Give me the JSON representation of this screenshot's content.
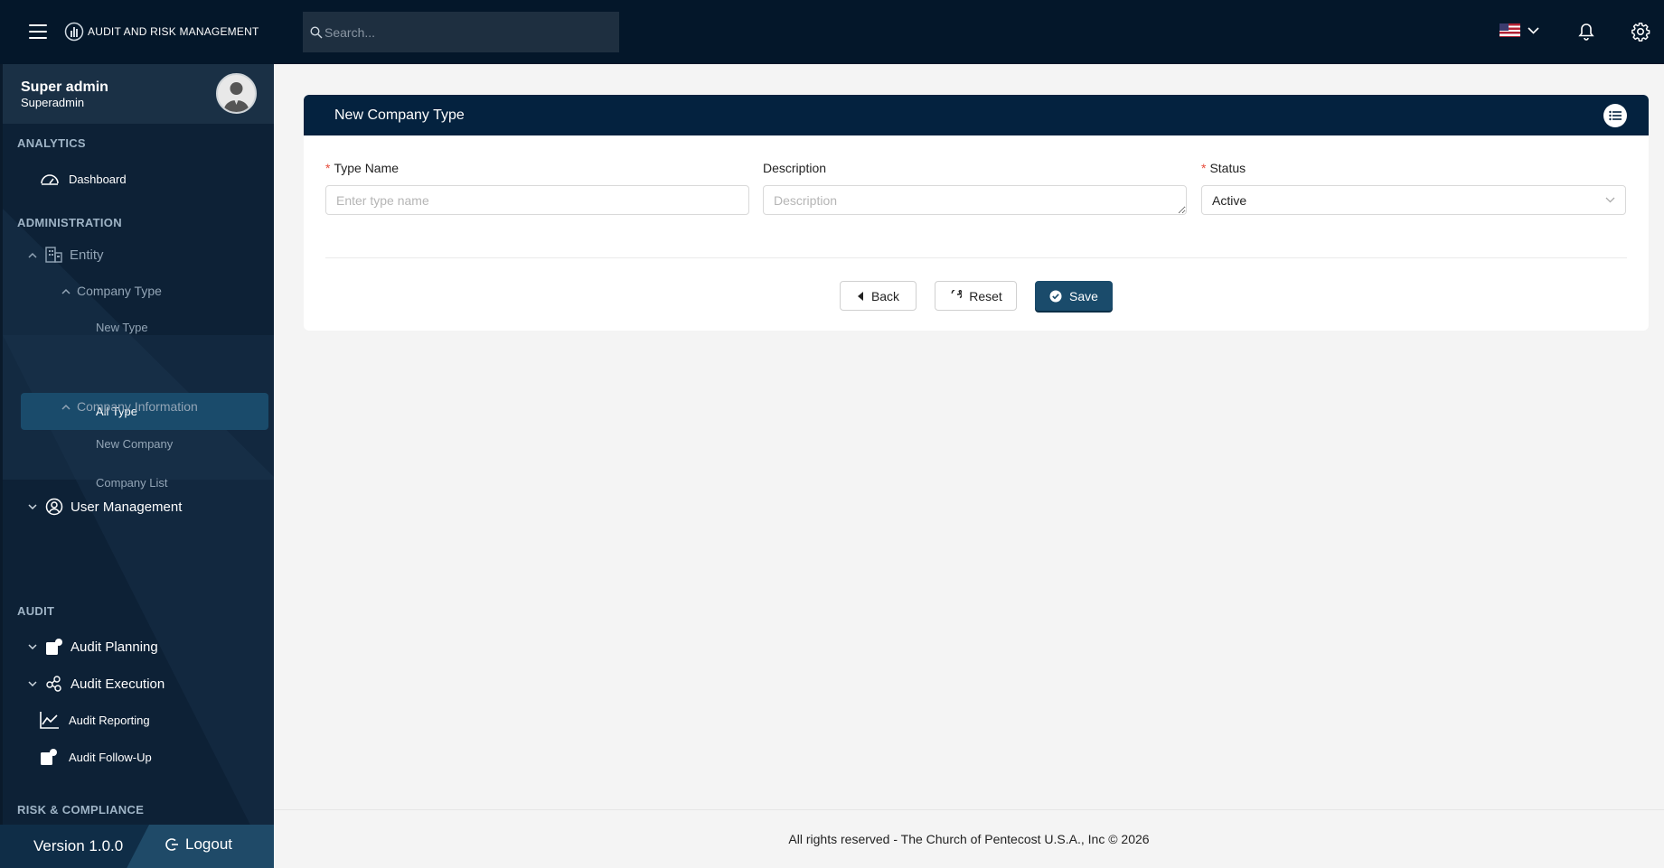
{
  "app": {
    "title": "AUDIT AND RISK MANAGEMENT"
  },
  "search": {
    "placeholder": "Search..."
  },
  "profile": {
    "name": "Super admin",
    "role": "Superadmin"
  },
  "sidebar": {
    "sections": {
      "analytics": "ANALYTICS",
      "administration": "ADMINISTRATION",
      "audit": "AUDIT",
      "risk": "RISK & COMPLIANCE"
    },
    "items": {
      "dashboard": "Dashboard",
      "entity": "Entity",
      "company_type": "Company Type",
      "new_type": "New Type",
      "all_type": "All Type",
      "company_information": "Company Information",
      "new_company": "New Company",
      "company_list": "Company List",
      "user_management": "User Management",
      "audit_planning": "Audit Planning",
      "audit_execution": "Audit Execution",
      "audit_reporting": "Audit Reporting",
      "audit_follow_up": "Audit Follow-Up"
    },
    "version": "Version 1.0.0",
    "logout": "Logout"
  },
  "card": {
    "title": "New Company Type",
    "type_name": {
      "label": "Type Name",
      "placeholder": "Enter type name",
      "value": ""
    },
    "description": {
      "label": "Description",
      "placeholder": "Description",
      "value": ""
    },
    "status": {
      "label": "Status",
      "value": "Active"
    },
    "buttons": {
      "back": "Back",
      "reset": "Reset",
      "save": "Save"
    }
  },
  "footer": {
    "text": "All rights reserved - The Church of Pentecost U.S.A., Inc © 2026"
  },
  "colors": {
    "topbar": "#04172a",
    "sidebar": "#0d2136",
    "accent": "#1a4b6b",
    "card_header": "#04223f",
    "required": "#e74c3c"
  }
}
